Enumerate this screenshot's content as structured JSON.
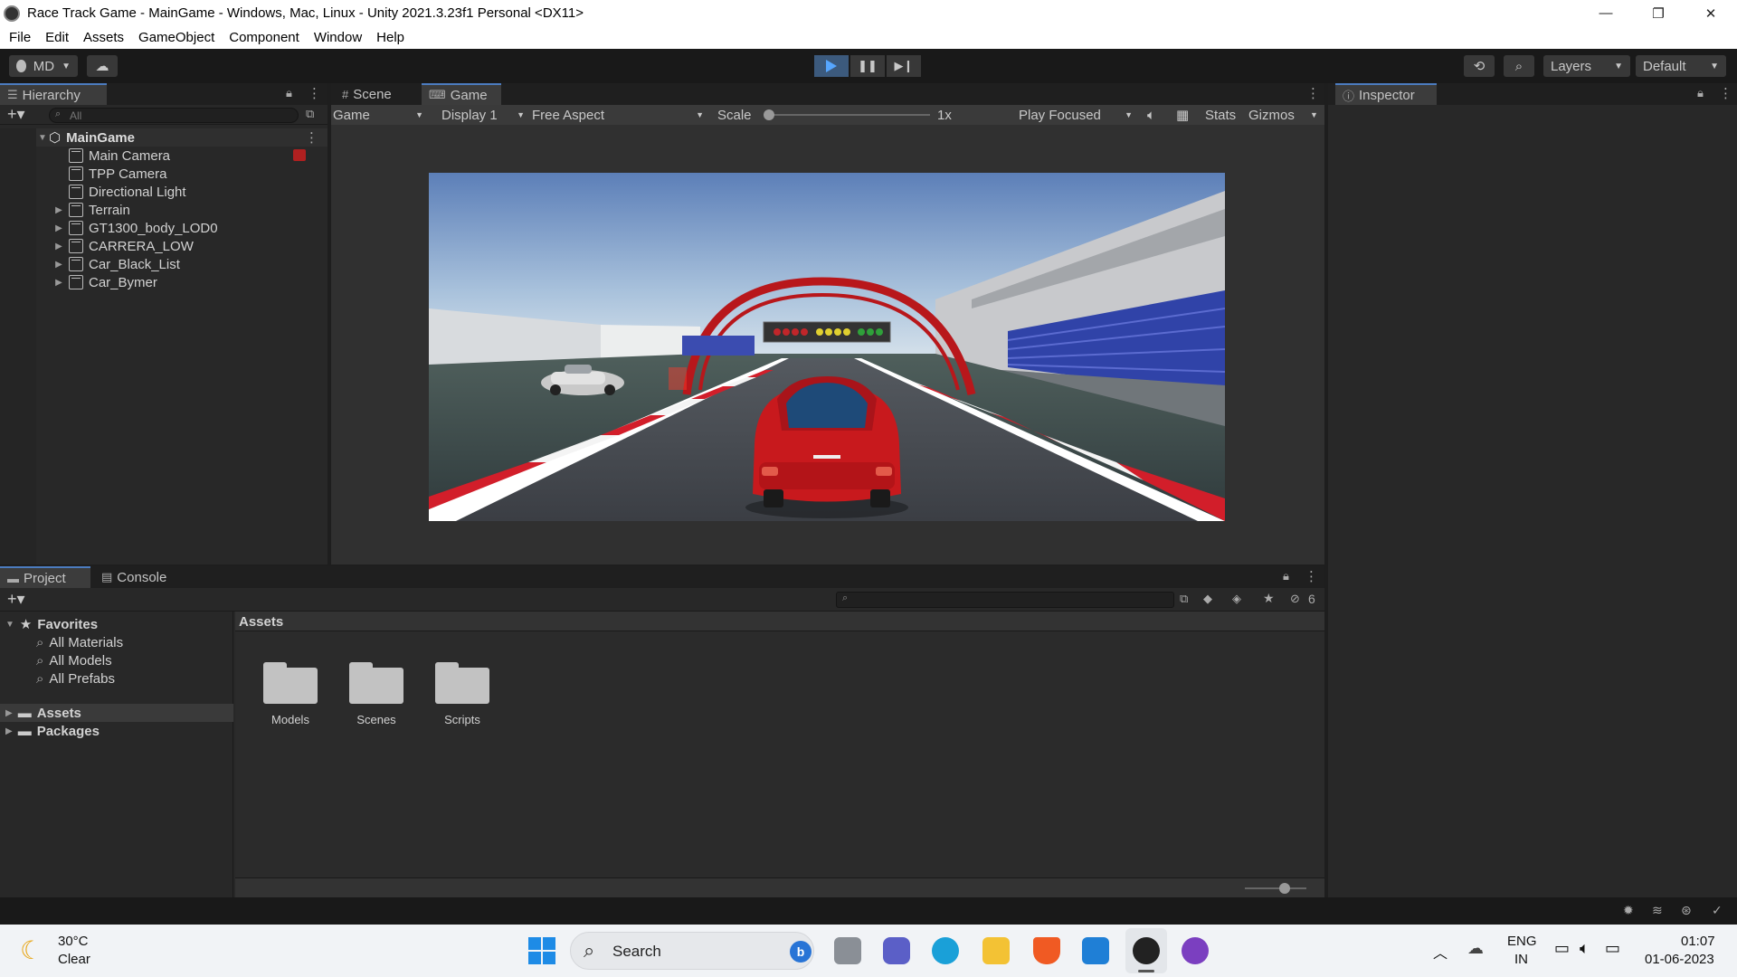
{
  "window": {
    "title": "Race Track Game - MainGame - Windows, Mac, Linux - Unity 2021.3.23f1 Personal <DX11>",
    "controls": [
      "—",
      "❐",
      "✕"
    ]
  },
  "menu": [
    "File",
    "Edit",
    "Assets",
    "GameObject",
    "Component",
    "Window",
    "Help"
  ],
  "toolbar": {
    "account": "MD",
    "layers": "Layers",
    "layout": "Default"
  },
  "hierarchy": {
    "tab": "Hierarchy",
    "search_placeholder": "All",
    "scene": "MainGame",
    "items": [
      {
        "label": "Main Camera",
        "expandable": false
      },
      {
        "label": "TPP Camera",
        "expandable": false
      },
      {
        "label": "Directional Light",
        "expandable": false
      },
      {
        "label": "Terrain",
        "expandable": true
      },
      {
        "label": "GT1300_body_LOD0",
        "expandable": true
      },
      {
        "label": "CARRERA_LOW",
        "expandable": true
      },
      {
        "label": "Car_Black_List",
        "expandable": true
      },
      {
        "label": "Car_Bymer",
        "expandable": true
      }
    ]
  },
  "gameview": {
    "tabs": [
      "Scene",
      "Game"
    ],
    "active_tab": "Game",
    "mode": "Game",
    "display": "Display 1",
    "aspect": "Free Aspect",
    "scale_label": "Scale",
    "scale_value": "1x",
    "play_mode": "Play Focused",
    "stats": "Stats",
    "gizmos": "Gizmos"
  },
  "inspector": {
    "tab": "Inspector"
  },
  "project": {
    "tabs": [
      "Project",
      "Console"
    ],
    "hidden_count": "6",
    "favorites_label": "Favorites",
    "favorites": [
      "All Materials",
      "All Models",
      "All Prefabs"
    ],
    "roots": [
      "Assets",
      "Packages"
    ],
    "breadcrumb": "Assets",
    "folders": [
      "Models",
      "Scenes",
      "Scripts"
    ]
  },
  "taskbar": {
    "weather_temp": "30°C",
    "weather_desc": "Clear",
    "search": "Search",
    "lang": "ENG",
    "region": "IN",
    "time": "01:07",
    "date": "01-06-2023"
  },
  "colors": {
    "play_accent": "#56a6ff",
    "tab_accent": "#4c7cbf",
    "car_red": "#c8191d",
    "arch_red": "#b8171b"
  }
}
